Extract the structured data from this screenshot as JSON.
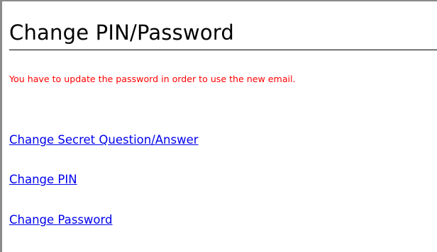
{
  "page": {
    "title": "Change PIN/Password",
    "notice": "You have to update the password in order to use the new email.",
    "links": [
      {
        "label": "Change Secret Question/Answer"
      },
      {
        "label": "Change PIN"
      },
      {
        "label": "Change Password"
      }
    ]
  },
  "colors": {
    "notice": "#ff0000",
    "link": "#0000ee",
    "frame_border": "#8a8a8a"
  }
}
